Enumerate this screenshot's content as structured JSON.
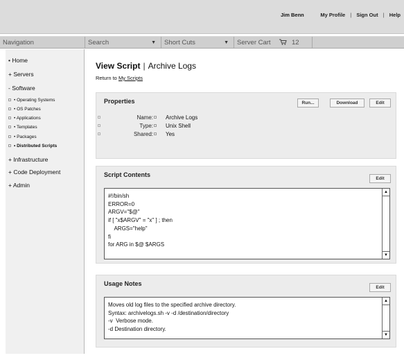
{
  "header": {
    "user_name": "Jim Benn",
    "links": [
      "My Profile",
      "Sign Out",
      "Help"
    ],
    "separator": "|"
  },
  "navbar": {
    "navigation_label": "Navigation",
    "search_label": "Search",
    "shortcuts_label": "Short Cuts",
    "server_cart_label": "Server Cart",
    "cart_count": "12",
    "dropdown_glyph": "▼",
    "cart_icon": "cart-icon"
  },
  "sidebar": {
    "items": [
      {
        "label": "• Home"
      },
      {
        "label": "+ Servers"
      },
      {
        "label": "- Software"
      }
    ],
    "software_children": [
      {
        "label": "• Operating Systems"
      },
      {
        "label": "• OS Patches"
      },
      {
        "label": "• Applications"
      },
      {
        "label": "• Templates"
      },
      {
        "label": "• Packages"
      },
      {
        "label": "• Distributed Scripts"
      }
    ],
    "bottom_items": [
      {
        "label": "+ Infrastructure"
      },
      {
        "label": "+ Code Deployment"
      },
      {
        "label": "+ Admin"
      }
    ]
  },
  "page": {
    "title_bold": "View Script",
    "title_sep": "|",
    "title_rest": "Archive Logs",
    "return_prefix": "Return to",
    "return_link": "My Scripts"
  },
  "properties": {
    "title": "Properties",
    "buttons": {
      "run": "Run...",
      "download": "Download",
      "edit": "Edit"
    },
    "rows": [
      {
        "label": "Name:",
        "value": "Archive Logs"
      },
      {
        "label": "Type:",
        "value": "Unix Shell"
      },
      {
        "label": "Shared:",
        "value": "Yes"
      }
    ]
  },
  "script_contents": {
    "title": "Script Contents",
    "edit": "Edit",
    "text": "#!/bin/sh\nERROR=0\nARGV=\"$@\"\nif [ \"x$ARGV\" = \"x\" ] ; then\n    ARGS=\"help\"\nfi\nfor ARG in $@ $ARGS"
  },
  "usage_notes": {
    "title": "Usage Notes",
    "edit": "Edit",
    "text": "Moves old log files to the specified archive directory.\nSyntax: archivelogs.sh -v -d /destination/directory\n-v  Verbose mode.\n-d Destination directory."
  },
  "colors": {
    "topbar": "#dcdcdc",
    "navbar": "#cfcfcf",
    "sidebar": "#f0f0f0",
    "panel": "#ececec"
  }
}
